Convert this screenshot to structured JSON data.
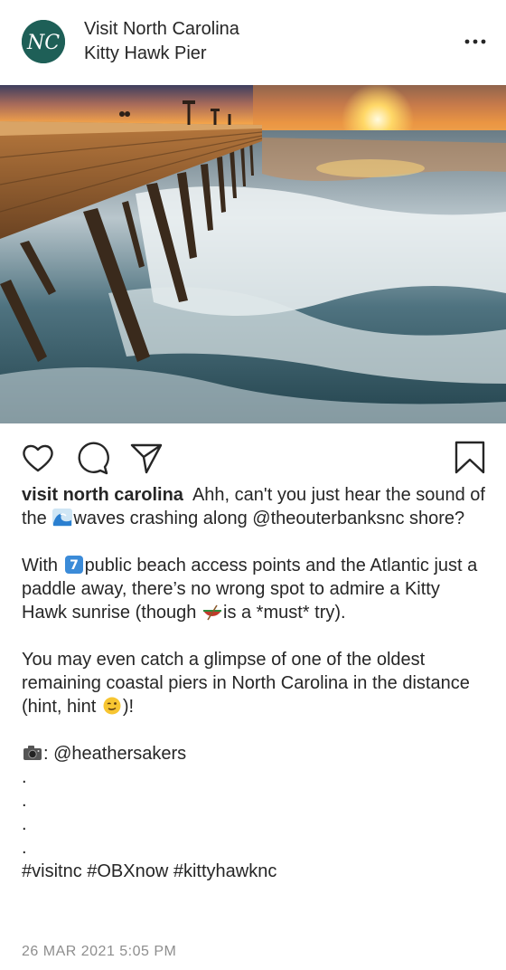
{
  "header": {
    "account_name": "Visit North Carolina",
    "location": "Kitty Hawk Pier",
    "avatar_text": "NC",
    "more_icon": "more-horizontal-icon"
  },
  "post": {
    "image_subject": "kitty-hawk-pier-sunrise-photo",
    "action_icons": [
      "heart-icon",
      "comment-icon",
      "share-icon",
      "bookmark-icon"
    ],
    "caption": {
      "username": "visit north carolina",
      "line1_a": "Ahh, can't you just hear the sound of the",
      "line1_b": "waves crashing along @theouterbanksnc shore?",
      "para2_a": "With",
      "para2_b": "public beach access points and the Atlantic just a paddle away, there’s no wrong spot to admire a Kitty Hawk sunrise (though",
      "para2_c": "is a *must* try).",
      "para3_a": "You may even catch a glimpse of one of the oldest remaining coastal piers in North Carolina in the distance (hint, hint",
      "para3_b": ")!",
      "credit_sep": ":",
      "credit_handle": "@heathersakers",
      "dots": [
        ".",
        ".",
        ".",
        "."
      ],
      "hashtags": "#visitnc #OBXnow #kittyhawknc"
    },
    "emojis": [
      "wave-emoji",
      "keycap-seven-emoji",
      "canoe-emoji",
      "winking-face-emoji",
      "camera-emoji"
    ],
    "date": "26 MAR 2021 5:05 PM"
  },
  "colors": {
    "avatar_bg": "#1e5f57",
    "text": "#262626",
    "meta_text": "#8e8e8e",
    "keycap_blue": "#3b8bd8"
  }
}
